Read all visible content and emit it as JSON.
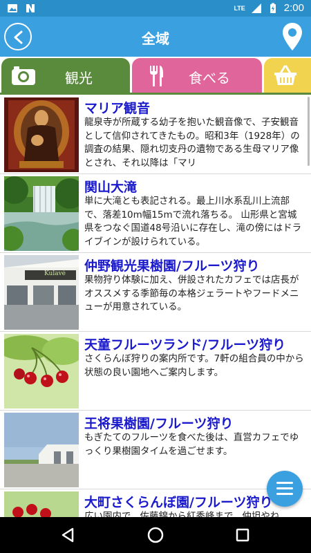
{
  "status": {
    "time": "2:00",
    "network": "LTE"
  },
  "header": {
    "title": "全域"
  },
  "tabs": [
    {
      "label": "観光",
      "icon": "camera-icon"
    },
    {
      "label": "食べる",
      "icon": "cutlery-icon"
    },
    {
      "label": "",
      "icon": "basket-icon"
    }
  ],
  "items": [
    {
      "title": "マリア観音",
      "desc": "龍泉寺が所蔵する幼子を抱いた観音像で、子安観音として信仰されてきたもの。昭和3年（1928年）の調査の結果、隠れ切支丹の遺物である生母マリア像とされ、それ以降は「マリ"
    },
    {
      "title": "関山大滝",
      "desc": "単に大滝とも表記される。最上川水系乱川上流部で、落差10m幅15mで流れ落ちる。 山形県と宮城県をつなぐ国道48号沿いに存在し、滝の傍にはドライブインが設けられている。"
    },
    {
      "title": "仲野観光果樹園/フルーツ狩り",
      "desc": "果物狩り体験に加え、併設されたカフェでは店長がオススメする季節毎の本格ジェラートやフードメニューが用意されている。"
    },
    {
      "title": "天童フルーツランド/フルーツ狩り",
      "desc": "さくらんぼ狩りの案内所です。7軒の組合員の中から状態の良い園地へご案内します。"
    },
    {
      "title": "王将果樹園/フルーツ狩り",
      "desc": "もぎたてのフルーツを食べた後は、直営カフェでゆっくり果樹園タイムを過ごせます。"
    },
    {
      "title": "大町さくらんぼ園/フルーツ狩り",
      "desc": "広い園内で、佐藤錦から紅秀峰まで、仲坦やね"
    }
  ],
  "cafe_sign": "Kulavé",
  "colors": {
    "header": "#3aa0e0",
    "kanko": "#5a8a3c",
    "taberu": "#e0659a",
    "kaimono": "#f2d350",
    "title": "#1a1acc"
  }
}
